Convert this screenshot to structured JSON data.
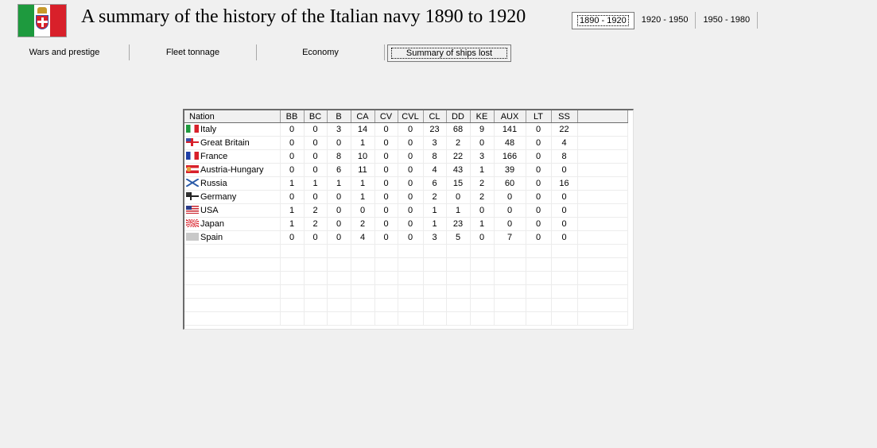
{
  "header": {
    "title": "A summary of the history of the Italian navy 1890 to 1920",
    "flag_icon": "italy-royal-flag-icon"
  },
  "era_tabs": [
    {
      "label": "1890 - 1920",
      "selected": true
    },
    {
      "label": "1920 - 1950",
      "selected": false
    },
    {
      "label": "1950 - 1980",
      "selected": false
    }
  ],
  "main_tabs": [
    {
      "label": "Wars and prestige",
      "selected": false
    },
    {
      "label": "Fleet tonnage",
      "selected": false
    },
    {
      "label": "Economy",
      "selected": false
    },
    {
      "label": "Summary of ships lost",
      "selected": true
    }
  ],
  "grid": {
    "columns": [
      "Nation",
      "BB",
      "BC",
      "B",
      "CA",
      "CV",
      "CVL",
      "CL",
      "DD",
      "KE",
      "AUX",
      "LT",
      "SS"
    ],
    "rows": [
      {
        "flag": "italy",
        "nation": "Italy",
        "values": [
          "0",
          "0",
          "3",
          "14",
          "0",
          "0",
          "23",
          "68",
          "9",
          "141",
          "0",
          "22"
        ]
      },
      {
        "flag": "gb",
        "nation": "Great Britain",
        "values": [
          "0",
          "0",
          "0",
          "1",
          "0",
          "0",
          "3",
          "2",
          "0",
          "48",
          "0",
          "4"
        ]
      },
      {
        "flag": "france",
        "nation": "France",
        "values": [
          "0",
          "0",
          "8",
          "10",
          "0",
          "0",
          "8",
          "22",
          "3",
          "166",
          "0",
          "8"
        ]
      },
      {
        "flag": "ah",
        "nation": "Austria-Hungary",
        "values": [
          "0",
          "0",
          "6",
          "11",
          "0",
          "0",
          "4",
          "43",
          "1",
          "39",
          "0",
          "0"
        ]
      },
      {
        "flag": "russia",
        "nation": "Russia",
        "values": [
          "1",
          "1",
          "1",
          "1",
          "0",
          "0",
          "6",
          "15",
          "2",
          "60",
          "0",
          "16"
        ]
      },
      {
        "flag": "germany",
        "nation": "Germany",
        "values": [
          "0",
          "0",
          "0",
          "1",
          "0",
          "0",
          "2",
          "0",
          "2",
          "0",
          "0",
          "0"
        ]
      },
      {
        "flag": "usa",
        "nation": "USA",
        "values": [
          "1",
          "2",
          "0",
          "0",
          "0",
          "0",
          "1",
          "1",
          "0",
          "0",
          "0",
          "0"
        ]
      },
      {
        "flag": "japan",
        "nation": "Japan",
        "values": [
          "1",
          "2",
          "0",
          "2",
          "0",
          "0",
          "1",
          "23",
          "1",
          "0",
          "0",
          "0"
        ]
      },
      {
        "flag": "spain",
        "nation": "Spain",
        "values": [
          "0",
          "0",
          "0",
          "4",
          "0",
          "0",
          "3",
          "5",
          "0",
          "7",
          "0",
          "0"
        ]
      }
    ],
    "empty_rows": 6
  },
  "colors": {
    "background": "#f0f0f0",
    "grid_background": "#ffffff",
    "italy_green": "#1e9a3e",
    "italy_red": "#d8202a"
  }
}
